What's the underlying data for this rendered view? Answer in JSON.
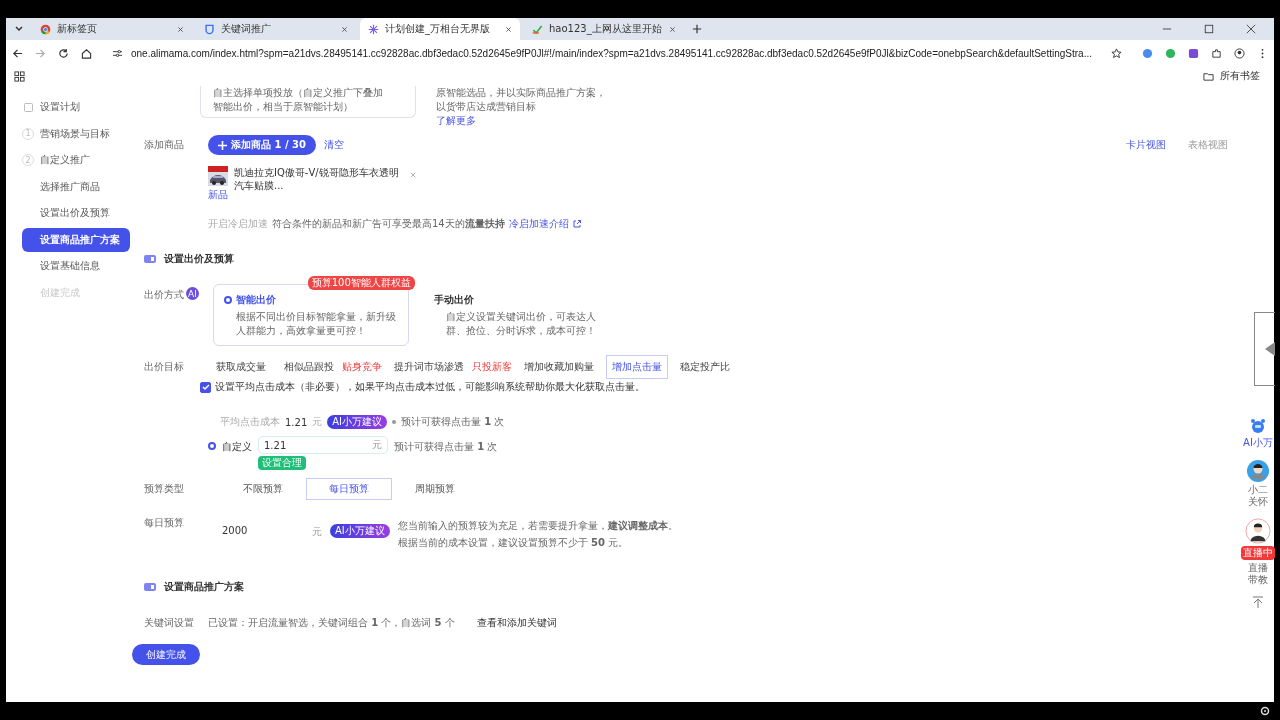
{
  "browser": {
    "tabs": [
      {
        "title": "新标签页",
        "selected": false
      },
      {
        "title": "关键词推广",
        "selected": false
      },
      {
        "title": "计划创建_万相台无界版",
        "selected": true
      },
      {
        "title": "hao123_上网从这里开始",
        "selected": false
      }
    ],
    "url": "one.alimama.com/index.html?spm=a21dvs.28495141.cc92828ac.dbf3edac0.52d2645e9fP0Jl#!/main/index?spm=a21dvs.28495141.cc92828ac.dbf3edac0.52d2645e9fP0Jl&bizCode=onebpSearch&defaultSettingStra...",
    "bookmarks_label": "所有书签"
  },
  "sidebar": {
    "items": [
      {
        "label": "设置计划",
        "selected": false,
        "disabled": false
      },
      {
        "label": "营销场景与目标",
        "marker": "1",
        "selected": false,
        "disabled": false
      },
      {
        "label": "自定义推广",
        "marker": "2",
        "selected": false,
        "disabled": false
      },
      {
        "label": "选择推广商品",
        "selected": false,
        "disabled": false
      },
      {
        "label": "设置出价及预算",
        "selected": false,
        "disabled": false
      },
      {
        "label": "设置商品推广方案",
        "selected": true,
        "disabled": false
      },
      {
        "label": "设置基础信息",
        "selected": false,
        "disabled": false
      },
      {
        "label": "创建完成",
        "selected": false,
        "disabled": true
      }
    ]
  },
  "top_cards": [
    {
      "lines": [
        "自主选择单项投放（自定义推广下叠加",
        "智能出价，相当于原智能计划）"
      ]
    },
    {
      "lines": [
        "原智能选品，并以实际商品推广方案，",
        "以货带店达成营销目标"
      ],
      "link": "了解更多"
    }
  ],
  "products": {
    "label": "添加商品",
    "add_button": "添加商品 1 / 30",
    "clear_link": "清空",
    "views": [
      {
        "label": "卡片视图",
        "selected": true
      },
      {
        "label": "表格视图",
        "selected": false
      }
    ],
    "items": [
      {
        "kind": "picture",
        "title": "凯迪拉克IQ傲哥-V/锐哥隐形车衣透明汽车贴膜...",
        "tag": "新品"
      }
    ],
    "cold_start": {
      "label": "开启冷启加速",
      "text": "符合条件的新品和新广告可享受最高14天的**流量扶持**",
      "link": "冷启加速介绍"
    }
  },
  "bidding": {
    "title": "设置出价及预算",
    "method_label": "出价方式",
    "method_badge": "AI",
    "methods": [
      {
        "title": "智能出价",
        "desc": "根据不同出价目标智能拿量，新升级人群能力，高效拿量更可控！",
        "ribbon": "预算100智能人群权益",
        "selected": true
      },
      {
        "title": "手动出价",
        "desc": "自定义设置关键词出价，可表达人群、抢位、分时诉求，成本可控！",
        "selected": false
      }
    ],
    "goal_label": "出价目标",
    "goals": [
      {
        "label": "获取成交量",
        "selected": false
      },
      {
        "label": "相似品跟投",
        "tag": "贴身竞争",
        "selected": false
      },
      {
        "label": "提升词市场渗透",
        "tag": "只投新客",
        "selected": false
      },
      {
        "label": "增加收藏加购量",
        "selected": false
      },
      {
        "label": "增加点击量",
        "selected": true
      },
      {
        "label": "稳定投产比",
        "selected": false
      }
    ],
    "avg_cost": {
      "checked": true,
      "text": "设置平均点击成本（非必要），如果平均点击成本过低，可能影响系统帮助你最大化获取点击量。"
    },
    "suggested": {
      "label": "平均点击成本",
      "value": "1.21",
      "unit": "元",
      "badge": "AI小万建议",
      "estimate": "预计可获得点击量 **1** 次"
    },
    "custom": {
      "label": "自定义",
      "selected": true,
      "value": "1.21",
      "unit": "元",
      "estimate": "预计可获得点击量 **1** 次",
      "hint": "设置合理"
    },
    "budget_type_label": "预算类型",
    "budget_types": [
      {
        "label": "不限预算",
        "selected": false
      },
      {
        "label": "每日预算",
        "selected": true
      },
      {
        "label": "周期预算",
        "selected": false
      }
    ],
    "daily_label": "每日预算",
    "daily_value": "2000",
    "daily_unit": "元",
    "daily_badge": "AI小万建议",
    "advice": [
      "您当前输入的预算较为充足，若需要提升拿量，**建议调整成本**。",
      "根据当前的成本设置，建议设置预算不少于 **50** 元。"
    ]
  },
  "plan": {
    "title": "设置商品推广方案",
    "keyword_label": "关键词设置",
    "keyword_text": "已设置：开启流量智选，关键词组合 **1** 个，自选词 **5** 个",
    "keyword_link": "查看和添加关键词"
  },
  "submit": "创建完成",
  "float_bar": {
    "ai": "AI小万",
    "service": "小二关怀",
    "live_badge": "直播中",
    "live": "直播带教"
  }
}
